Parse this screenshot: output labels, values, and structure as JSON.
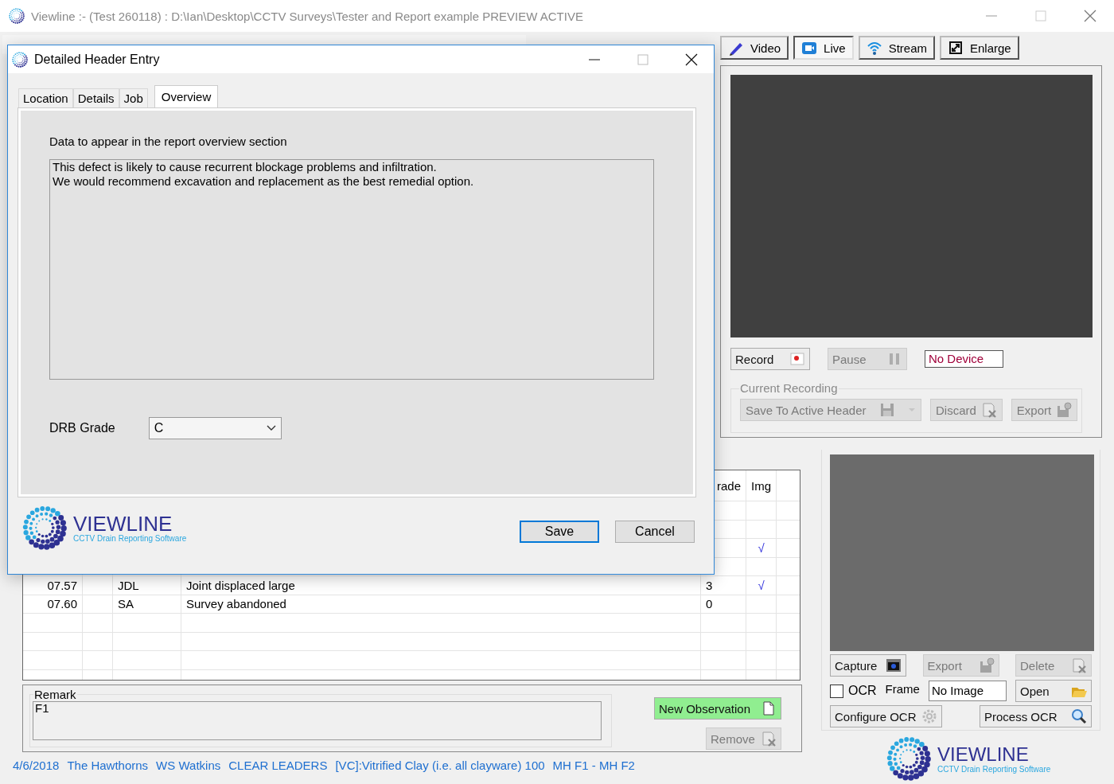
{
  "window": {
    "title": "Viewline :- (Test 260118) : D:\\Ian\\Desktop\\CCTV Surveys\\Tester and Report example  PREVIEW ACTIVE"
  },
  "view_tabs": [
    {
      "label": "Video",
      "selected": false
    },
    {
      "label": "Live",
      "selected": true
    },
    {
      "label": "Stream",
      "selected": false
    },
    {
      "label": "Enlarge",
      "selected": false
    }
  ],
  "video_panel": {
    "record": {
      "label": "Record",
      "disabled": false
    },
    "pause": {
      "label": "Pause",
      "disabled": true
    },
    "device": "No Device",
    "recording": {
      "title": "Current Recording",
      "buttons": [
        {
          "label": "Save To Active Header",
          "kind": "split",
          "disabled": true
        },
        {
          "label": "Discard",
          "kind": "plain",
          "disabled": true
        },
        {
          "label": "Export",
          "kind": "plain",
          "disabled": true
        }
      ]
    }
  },
  "table": {
    "columns": {
      "column_5": "rade",
      "column_6": "Img"
    },
    "rows": [
      {},
      {},
      {
        "column_6": "√"
      },
      {},
      {
        "column_1": "07.57",
        "column_3": "JDL",
        "column_4": "Joint displaced large",
        "column_5": "3",
        "column_6": "√"
      },
      {
        "column_1": "07.60",
        "column_3": "SA",
        "column_4": "Survey abandoned",
        "column_5": "0"
      }
    ]
  },
  "remark": {
    "title": "Remark",
    "value": "F1"
  },
  "new_observation": {
    "label": "New Observation",
    "disabled": false
  },
  "remove": {
    "label": "Remove",
    "disabled": true
  },
  "status_bar": [
    "4/6/2018",
    "The Hawthorns",
    "WS Watkins",
    "CLEAR LEADERS",
    "[VC]:Vitrified Clay (i.e. all clayware) 100",
    "MH F1 - MH F2"
  ],
  "image_panel": {
    "capture": {
      "label": "Capture",
      "disabled": false
    },
    "export": {
      "label": "Export",
      "disabled": true
    },
    "delete": {
      "label": "Delete",
      "disabled": true
    },
    "ocr": {
      "label": "OCR",
      "checked": false
    },
    "frame_label": "Frame",
    "frame_value": "No Image",
    "open": {
      "label": "Open",
      "disabled": false
    },
    "configure": {
      "label": "Configure OCR",
      "disabled": false
    },
    "process": {
      "label": "Process OCR",
      "disabled": false
    }
  },
  "logo": {
    "name": "VIEWLINE",
    "tagline": "CCTV Drain Reporting Software"
  },
  "dialog": {
    "title": "Detailed Header Entry",
    "tabs": [
      {
        "label": "Location",
        "selected": false
      },
      {
        "label": "Details",
        "selected": false
      },
      {
        "label": "Job",
        "selected": false
      },
      {
        "label": "Overview",
        "selected": true
      }
    ],
    "caption": "Data to appear in the report overview section",
    "overview": "This defect is likely to cause recurrent blockage problems and infiltration.\nWe would recommend excavation and replacement as the best remedial option.",
    "grade_label": "DRB Grade",
    "grade_value": "C",
    "buttons": [
      {
        "label": "Save",
        "kind": "default"
      },
      {
        "label": "Cancel",
        "kind": "normal"
      }
    ],
    "logo": {
      "name": "VIEWLINE",
      "tagline": "CCTV Drain Reporting Software"
    }
  }
}
